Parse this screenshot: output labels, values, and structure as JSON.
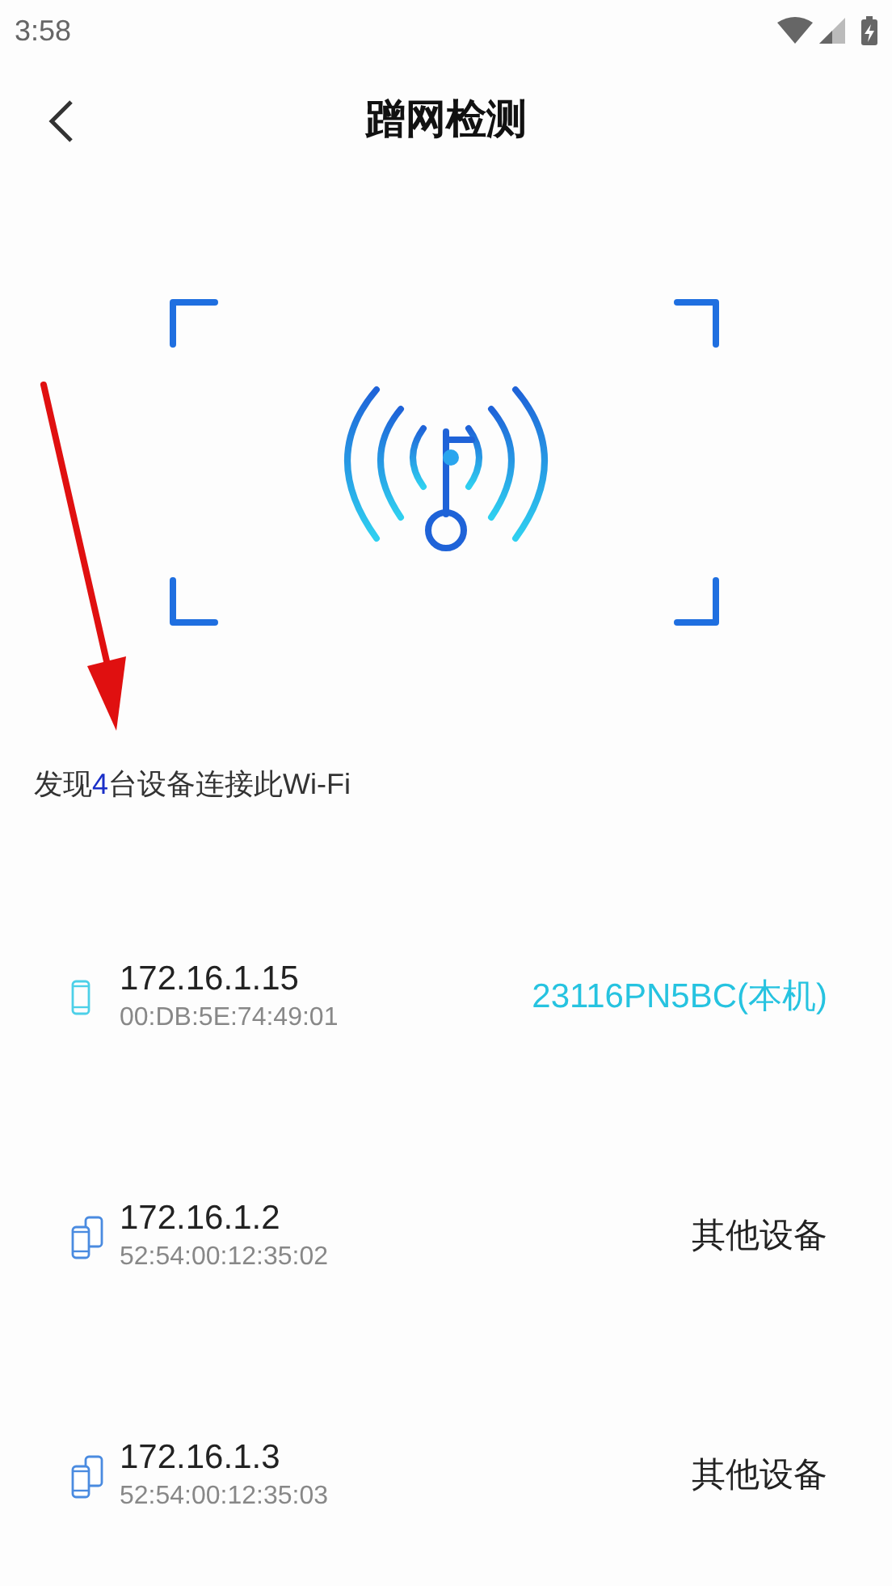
{
  "status_bar": {
    "time": "3:58"
  },
  "header": {
    "title": "蹭网检测"
  },
  "summary": {
    "prefix": "发现",
    "count": "4",
    "suffix": "台设备连接此Wi-Fi"
  },
  "devices": [
    {
      "kind": "self",
      "ip": "172.16.1.15",
      "mac": "00:DB:5E:74:49:01",
      "label": "23116PN5BC(本机)"
    },
    {
      "kind": "other",
      "ip": "172.16.1.2",
      "mac": "52:54:00:12:35:02",
      "label": "其他设备"
    },
    {
      "kind": "other",
      "ip": "172.16.1.3",
      "mac": "52:54:00:12:35:03",
      "label": "其他设备"
    }
  ]
}
